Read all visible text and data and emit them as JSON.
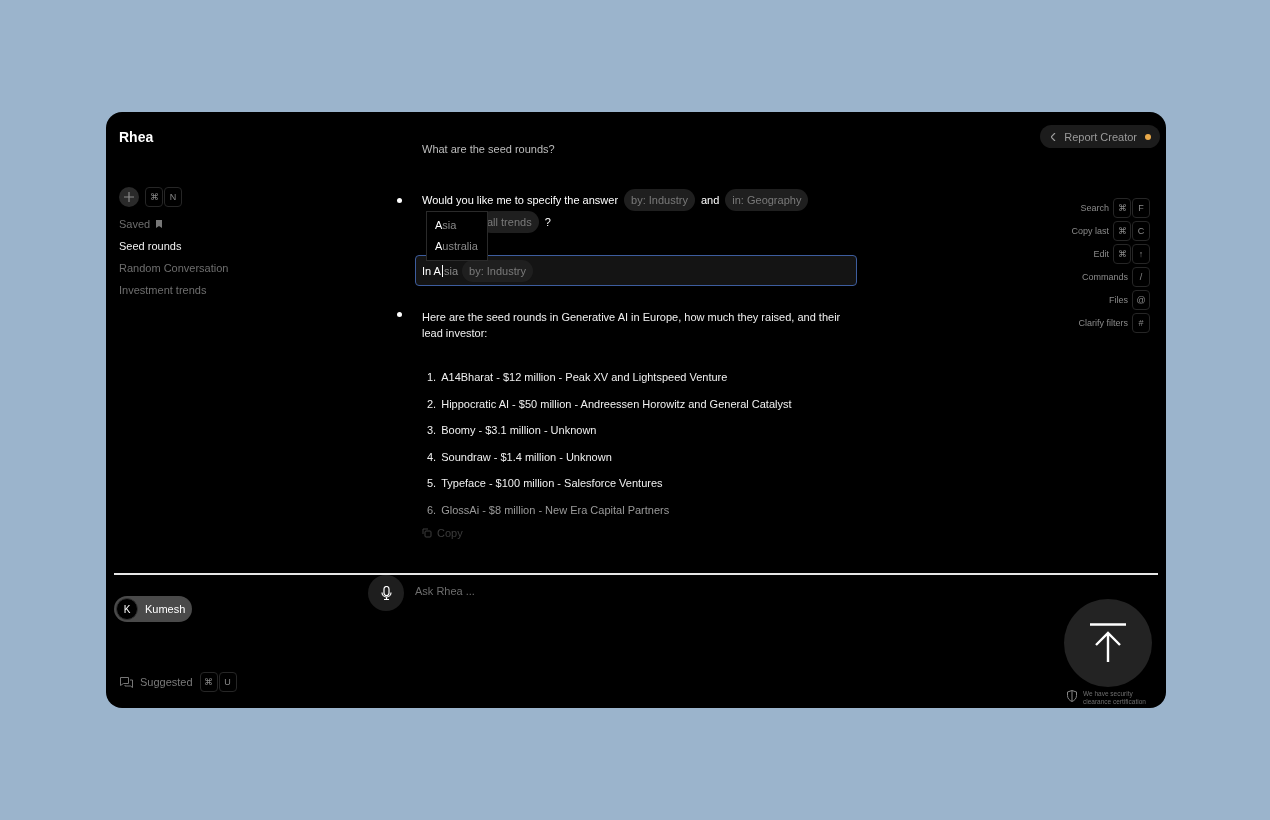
{
  "app": {
    "title": "Rhea"
  },
  "sidebar": {
    "new_chat_keys": [
      "⌘",
      "N"
    ],
    "saved_label": "Saved",
    "conversations": [
      {
        "label": "Seed rounds",
        "selected": true
      },
      {
        "label": "Random Conversation",
        "selected": false
      },
      {
        "label": "Investment trends",
        "selected": false
      }
    ]
  },
  "chat": {
    "question": "What are the seed rounds?",
    "clarify": {
      "line_1": [
        {
          "kind": "text",
          "text": "Would you like me to specify the answer"
        },
        {
          "kind": "chip",
          "text": "by: Industry"
        },
        {
          "kind": "text",
          "text": "and"
        },
        {
          "kind": "chip",
          "text": "in: Geography"
        }
      ],
      "line_2": [
        {
          "kind": "chip",
          "text": "all trends"
        },
        {
          "kind": "text",
          "text": "?"
        }
      ],
      "suggestions": [
        {
          "match": "A",
          "rest": "sia"
        },
        {
          "match": "A",
          "rest": "ustralia"
        }
      ],
      "input": {
        "value": "In A",
        "suggestion": "sia",
        "chips": [
          "by: Industry"
        ]
      }
    },
    "answer": {
      "intro": "Here are the seed rounds in Generative AI in Europe, how much they raised, and their lead investor:",
      "items": [
        {
          "number": "1.",
          "text": "A14Bharat - $12 million - Peak XV and Lightspeed Venture",
          "dimmed": false
        },
        {
          "number": "2.",
          "text": "Hippocratic AI - $50 million - Andreessen Horowitz and General Catalyst",
          "dimmed": false
        },
        {
          "number": "3.",
          "text": "Boomy - $3.1 million - Unknown",
          "dimmed": false
        },
        {
          "number": "4.",
          "text": "Soundraw - $1.4 million - Unknown",
          "dimmed": false
        },
        {
          "number": "5.",
          "text": "Typeface - $100 million - Salesforce Ventures",
          "dimmed": false
        },
        {
          "number": "6.",
          "text": "GlossAi - $8 million - New Era Capital Partners",
          "dimmed": true
        }
      ],
      "copy_label": "Copy"
    }
  },
  "header": {
    "back_label": "Report Creator"
  },
  "shortcuts": [
    {
      "label": "Search",
      "keys": [
        "⌘",
        "F"
      ]
    },
    {
      "label": "Copy last",
      "keys": [
        "⌘",
        "C"
      ]
    },
    {
      "label": "Edit",
      "keys": [
        "⌘",
        "↑"
      ]
    },
    {
      "label": "Commands",
      "keys": [
        "/"
      ]
    },
    {
      "label": "Files",
      "keys": [
        "@"
      ]
    },
    {
      "label": "Clarify filters",
      "keys": [
        "#"
      ]
    }
  ],
  "composer": {
    "user": {
      "initial": "K",
      "name": "Kumesh"
    },
    "placeholder": "Ask Rhea ...",
    "suggested": {
      "label": "Suggested",
      "keys": [
        "⌘",
        "U"
      ]
    },
    "security_note": "We have security clearance certification"
  }
}
